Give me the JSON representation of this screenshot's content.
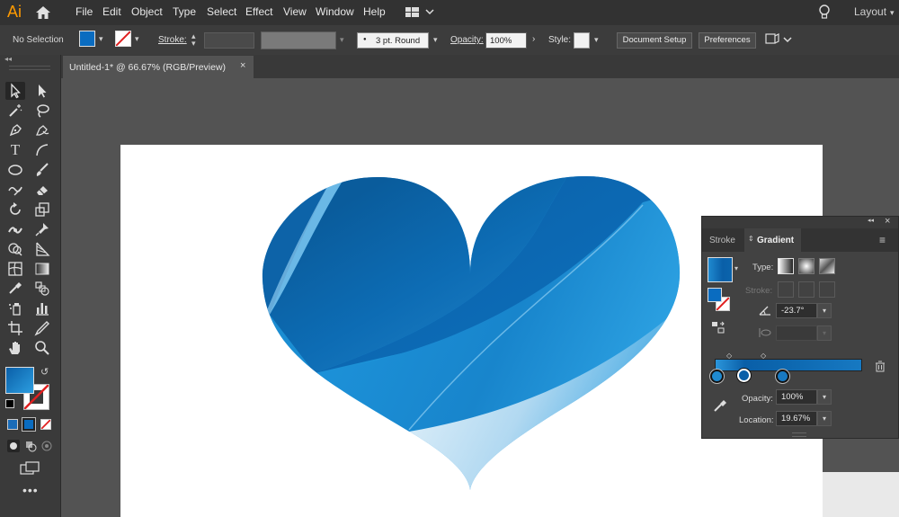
{
  "app": {
    "logo": "Ai",
    "layout_label": "Layout"
  },
  "menu": {
    "items": [
      "File",
      "Edit",
      "Object",
      "Type",
      "Select",
      "Effect",
      "View",
      "Window",
      "Help"
    ]
  },
  "control": {
    "selection": "No Selection",
    "stroke_label": "Stroke:",
    "brush": "3 pt. Round",
    "opacity_label": "Opacity:",
    "opacity_value": "100%",
    "style_label": "Style:",
    "doc_setup": "Document Setup",
    "preferences": "Preferences"
  },
  "document": {
    "tab_title": "Untitled-1* @ 66.67% (RGB/Preview)"
  },
  "panel": {
    "tabs": [
      "Stroke",
      "Gradient"
    ],
    "active_tab": "Gradient",
    "type_label": "Type:",
    "stroke_label": "Stroke:",
    "angle": "-23.7°",
    "opacity_label": "Opacity:",
    "opacity_value": "100%",
    "location_label": "Location:",
    "location_value": "19.67%"
  },
  "colors": {
    "gradient_dark": "#0a5fa8",
    "gradient_light": "#2c9ee0",
    "stroke_none_red": "#e02020"
  },
  "icons": [
    "home-icon",
    "workspace-icon",
    "lightbulb-icon",
    "selection-tool-icon",
    "direct-selection-tool-icon",
    "magic-wand-icon",
    "lasso-icon",
    "pen-icon",
    "curvature-icon",
    "type-icon",
    "line-icon",
    "ellipse-icon",
    "paintbrush-icon",
    "shaper-icon",
    "eraser-icon",
    "rotate-icon",
    "scale-icon",
    "width-icon",
    "puppet-warp-icon",
    "shape-builder-icon",
    "perspective-icon",
    "mesh-icon",
    "gradient-icon",
    "eyedropper-icon",
    "blend-icon",
    "symbol-sprayer-icon",
    "graph-icon",
    "artboard-icon",
    "slice-icon",
    "hand-icon",
    "zoom-icon",
    "trash-icon"
  ]
}
